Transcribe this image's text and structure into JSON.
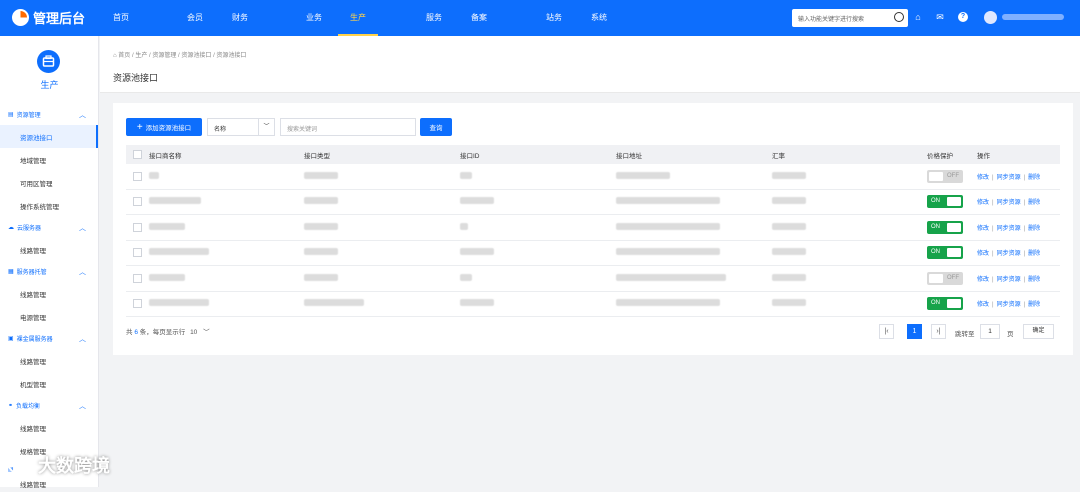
{
  "header": {
    "logo_text": "管理后台",
    "nav": [
      "首页",
      "会员",
      "财务",
      "业务",
      "生产",
      "服务",
      "备案",
      "站务",
      "系统"
    ],
    "active_nav": "生产",
    "search_placeholder": "输入功能关键字进行搜索"
  },
  "sidebar": {
    "title": "生产",
    "groups": [
      {
        "label": "资源管理",
        "items": [
          "资源池接口",
          "地域管理",
          "可用区管理",
          "操作系统管理"
        ]
      },
      {
        "label": "云服务器",
        "items": [
          "线路管理"
        ]
      },
      {
        "label": "服务器托管",
        "items": [
          "线路管理",
          "电源管理"
        ]
      },
      {
        "label": "裸金属服务器",
        "items": [
          "线路管理",
          "机型管理"
        ]
      },
      {
        "label": "负载均衡",
        "items": [
          "线路管理",
          "规格管理"
        ]
      },
      {
        "label": "",
        "items": [
          "线路管理"
        ]
      }
    ],
    "active_item": "资源池接口"
  },
  "breadcrumb": [
    "首页",
    "生产",
    "资源管理",
    "资源池接口",
    "资源池接口"
  ],
  "page_title": "资源池接口",
  "toolbar": {
    "add_button": "添加资源池接口",
    "select_value": "名称",
    "keyword_placeholder": "搜索关键词",
    "query_button": "查询"
  },
  "table": {
    "columns": [
      "接口商名称",
      "接口类型",
      "接口ID",
      "接口地址",
      "汇率",
      "价格保护",
      "操作"
    ],
    "rows": [
      {
        "price_protect": "OFF"
      },
      {
        "price_protect": "ON"
      },
      {
        "price_protect": "ON"
      },
      {
        "price_protect": "ON"
      },
      {
        "price_protect": "OFF"
      },
      {
        "price_protect": "ON"
      }
    ],
    "ops": [
      "修改",
      "同步资源",
      "删除"
    ]
  },
  "pagination": {
    "total_prefix": "共",
    "total": "6",
    "total_suffix": "条，每页显示行",
    "page_size": "10",
    "current": "1",
    "jump_label": "跳转至",
    "jump_value": "1",
    "page_unit": "页",
    "confirm": "确定"
  },
  "watermark": "大数跨境",
  "colors": {
    "primary": "#0d6efd",
    "on": "#16a34a",
    "off": "#d9d9d9"
  }
}
